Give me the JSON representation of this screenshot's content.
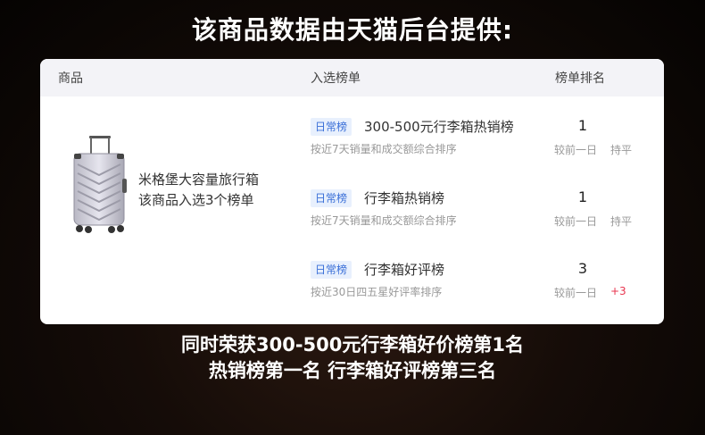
{
  "headline": "该商品数据由天猫后台提供:",
  "table": {
    "col_product": "商品",
    "col_list": "入选榜单",
    "col_rank": "榜单排名"
  },
  "product": {
    "image_icon": "suitcase-icon",
    "name": "米格堡大容量旅行箱",
    "note": "该商品入选3个榜单"
  },
  "rankings": [
    {
      "tag": "日常榜",
      "name": "300-500元行李箱热销榜",
      "desc": "按近7天销量和成交额综合排序",
      "rank": "1",
      "compare": "较前一日",
      "change": "持平"
    },
    {
      "tag": "日常榜",
      "name": "行李箱热销榜",
      "desc": "按近7天销量和成交额综合排序",
      "rank": "1",
      "compare": "较前一日",
      "change": "持平"
    },
    {
      "tag": "日常榜",
      "name": "行李箱好评榜",
      "desc": "按近30日四五星好评率排序",
      "rank": "3",
      "compare": "较前一日",
      "change": "+3"
    }
  ],
  "footer": {
    "line1": "同时荣获300-500元行李箱好价榜第1名",
    "line2": "热销榜第一名 行李箱好评榜第三名"
  },
  "colors": {
    "tag_text": "#3a6fd8",
    "tag_bg": "#e8f0fd",
    "rank_up": "#e8344e",
    "header_bg": "#f3f3f7"
  }
}
